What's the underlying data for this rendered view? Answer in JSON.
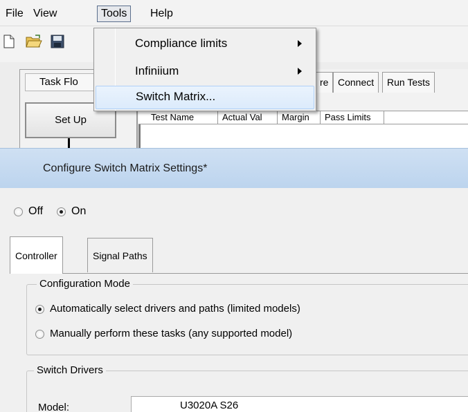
{
  "menubar": {
    "items": [
      "File",
      "View",
      "Tools",
      "Help"
    ],
    "open_item": "Tools"
  },
  "toolbar": {
    "icons": [
      "new-document-icon",
      "open-folder-icon",
      "save-disk-icon"
    ]
  },
  "taskflow": {
    "title": "Task Flo",
    "setup_label": "Set Up"
  },
  "bg_tabs": [
    "re",
    "Connect",
    "Run Tests"
  ],
  "grid": {
    "columns": [
      "Test Name",
      "Actual Val",
      "Margin",
      "Pass Limits"
    ]
  },
  "tools_menu": {
    "items": [
      {
        "label": "Compliance limits",
        "submenu": true
      },
      {
        "label": "Infiniium",
        "submenu": true
      },
      {
        "label": "Switch Matrix...",
        "submenu": false,
        "highlighted": true
      }
    ]
  },
  "dialog": {
    "title": "Configure Switch Matrix Settings*",
    "power": {
      "off_label": "Off",
      "on_label": "On",
      "selected": "On"
    },
    "tabs": [
      "Controller",
      "Signal Paths"
    ],
    "active_tab": "Controller",
    "configuration_mode": {
      "legend": "Configuration Mode",
      "options": [
        "Automatically select drivers and paths (limited models)",
        "Manually perform these tasks (any supported model)"
      ],
      "selected_index": 0
    },
    "switch_drivers": {
      "legend": "Switch Drivers",
      "model_label": "Model:",
      "model_value": "U3020A S26"
    }
  },
  "colors": {
    "titlebar": "#c4d8ef",
    "menu_highlight": "#dcebfc",
    "dialog_bg": "#f0f0f0"
  }
}
